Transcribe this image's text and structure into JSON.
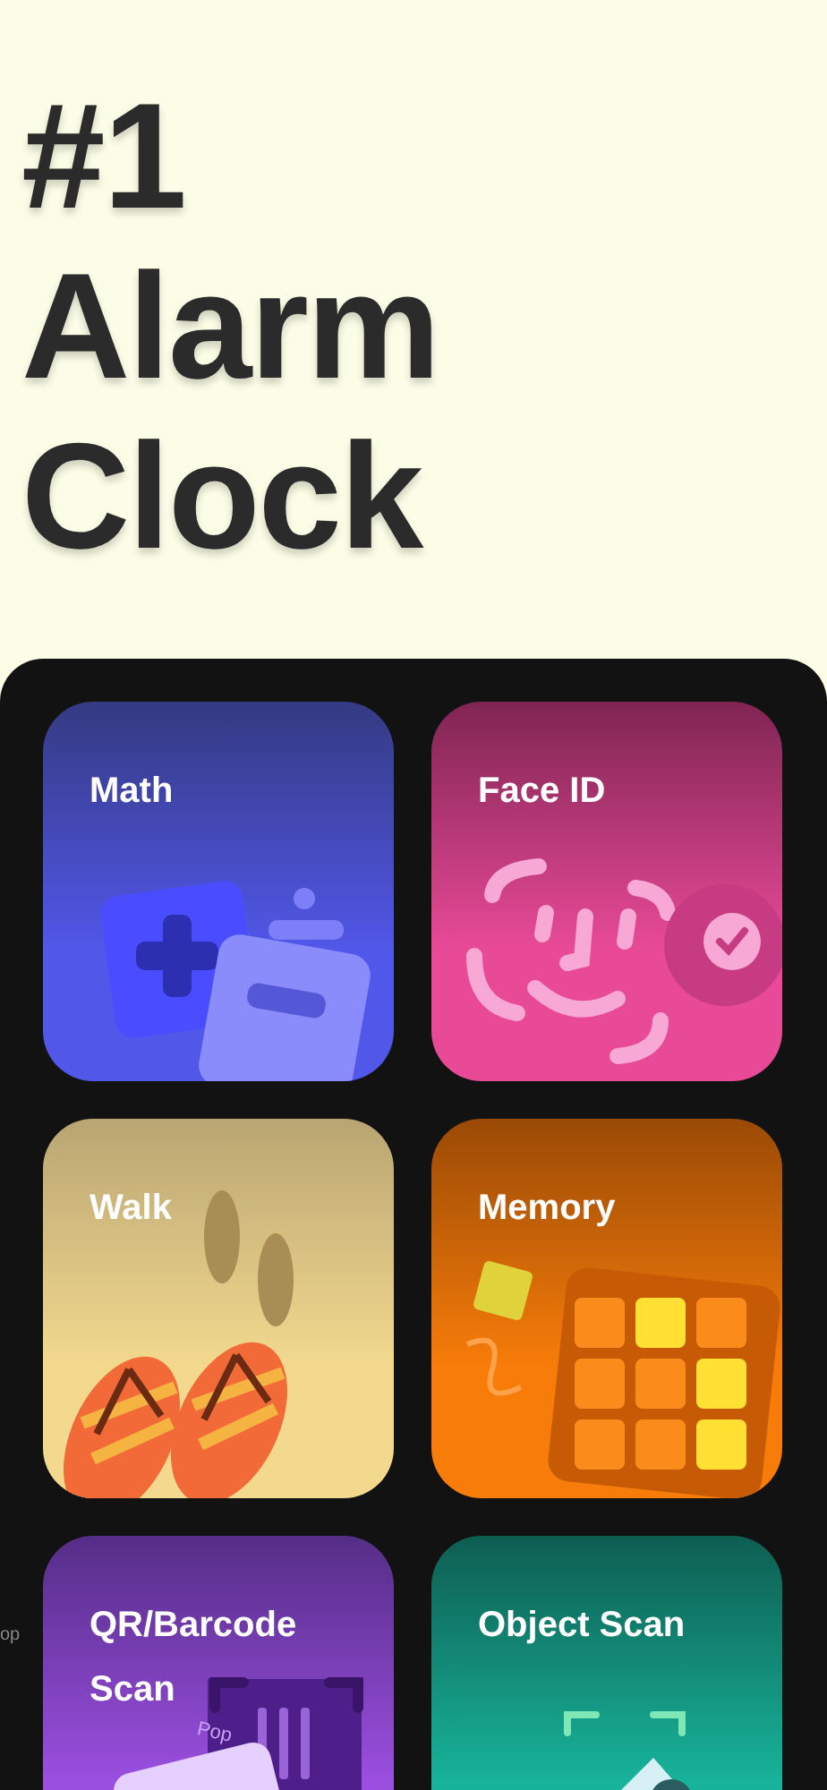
{
  "headline": [
    "#1",
    "Alarm",
    "Clock"
  ],
  "edge_text": "op",
  "cards": [
    {
      "title": "Math",
      "kind": "math",
      "color": "#5157e8"
    },
    {
      "title": "Face ID",
      "kind": "face",
      "color": "#e84a98"
    },
    {
      "title": "Walk",
      "kind": "walk",
      "color": "#f2d98e"
    },
    {
      "title": "Memory",
      "kind": "memory",
      "color": "#f77c0a"
    },
    {
      "title": "QR/Barcode Scan",
      "kind": "qr",
      "color": "#9b4fe0",
      "sticker": "Pop"
    },
    {
      "title": "Object Scan",
      "kind": "object",
      "color": "#17b39a"
    }
  ]
}
